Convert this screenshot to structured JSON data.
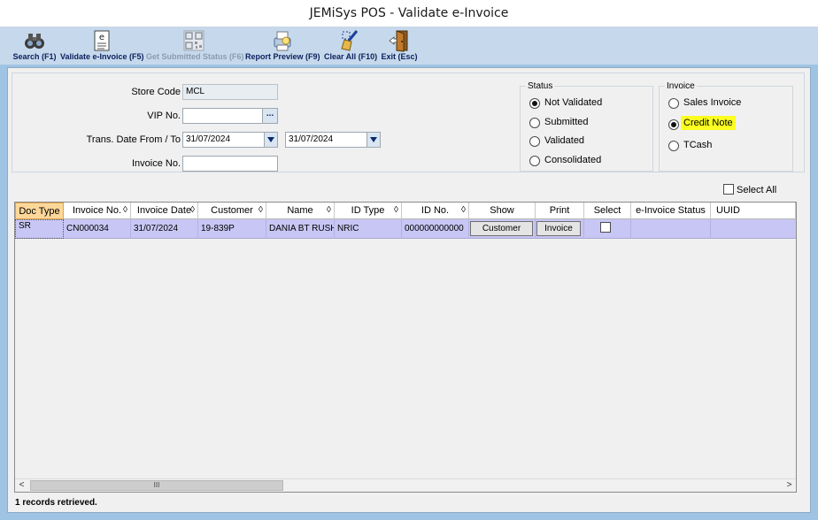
{
  "window": {
    "title": "JEMiSys POS - Validate e-Invoice"
  },
  "toolbar": {
    "items": [
      {
        "label": "Search (F1)",
        "icon": "binoculars-icon"
      },
      {
        "label": "Validate e-Invoice (F5)",
        "icon": "e-invoice-document-icon"
      },
      {
        "label": "Get Submitted Status (F6)",
        "icon": "qr-code-icon",
        "disabled": true
      },
      {
        "label": "Report Preview (F9)",
        "icon": "printer-preview-icon"
      },
      {
        "label": "Clear All (F10)",
        "icon": "broom-icon"
      },
      {
        "label": "Exit (Esc)",
        "icon": "exit-door-icon"
      }
    ]
  },
  "criteria": {
    "store_code_label": "Store Code",
    "store_code_value": "MCL",
    "vip_label": "VIP No.",
    "vip_value": "",
    "vip_button": "...",
    "date_label": "Trans. Date From / To",
    "date_from": "31/07/2024",
    "date_to": "31/07/2024",
    "invoice_label": "Invoice No.",
    "invoice_value": ""
  },
  "status_group": {
    "title": "Status",
    "options": [
      "Not Validated",
      "Submitted",
      "Validated",
      "Consolidated"
    ],
    "selected": "Not Validated"
  },
  "invoice_group": {
    "title": "Invoice",
    "options": [
      "Sales Invoice",
      "Credit Note",
      "TCash"
    ],
    "selected": "Credit Note",
    "highlight_color": "#fbff21"
  },
  "select_all_label": "Select All",
  "grid": {
    "columns": [
      "Doc Type",
      "Invoice No.",
      "Invoice Date",
      "Customer",
      "Name",
      "ID Type",
      "ID No.",
      "Show",
      "Print",
      "Select",
      "e-Invoice Status",
      "UUID"
    ],
    "rows": [
      {
        "doc_type": "SR",
        "invoice_no": "CN000034",
        "invoice_date": "31/07/2024",
        "customer": "19-839P",
        "name": "DANIA BT RUSHDI",
        "id_type": "NRIC",
        "id_no": "000000000000",
        "show_button": "Customer",
        "print_button": "Invoice",
        "selected": false,
        "einvoice_status": "",
        "uuid": ""
      }
    ],
    "scroll_thumb": "III"
  },
  "status_bar": {
    "text": "1 records retrieved."
  },
  "colors": {
    "row_bg": "#c8c6f4",
    "sorted_header_bg": "#fcd799",
    "toolbar_bg": "#c6d9ec"
  }
}
